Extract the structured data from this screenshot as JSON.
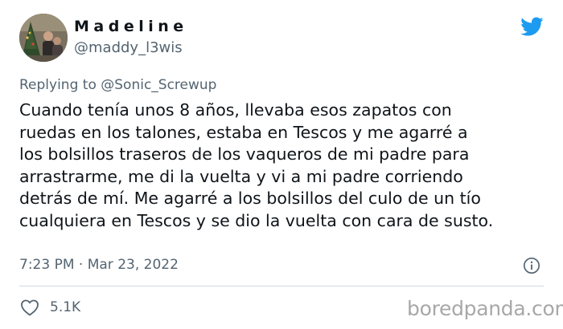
{
  "author": {
    "display_name": "Madeline",
    "handle": "@maddy_l3wis"
  },
  "reply": {
    "prefix": "Replying to",
    "target": "@Sonic_Screwup"
  },
  "tweet": {
    "lines": [
      "Cuando tenía unos 8 años, llevaba esos zapatos con",
      "ruedas en los talones, estaba en Tescos y me agarré a",
      "los bolsillos traseros de los vaqueros de mi padre para",
      "arrastrarme, me di la vuelta y vi a mi padre corriendo",
      "detrás de mí. Me agarré a los bolsillos del culo de un tío",
      "cualquiera en Tescos y se dio la vuelta con cara de susto."
    ],
    "timestamp": "7:23 PM · Mar 23, 2022"
  },
  "actions": {
    "like_count": "5.1K"
  },
  "watermark": "boredpanda.com",
  "icons": {
    "brand": "twitter-bird-icon",
    "info": "info-icon",
    "like": "heart-icon"
  },
  "colors": {
    "twitter_blue": "#1d9bf0",
    "text_primary": "#0f1419",
    "text_secondary": "#536471",
    "divider": "#cfd9de",
    "watermark": "#a8a8a8"
  }
}
